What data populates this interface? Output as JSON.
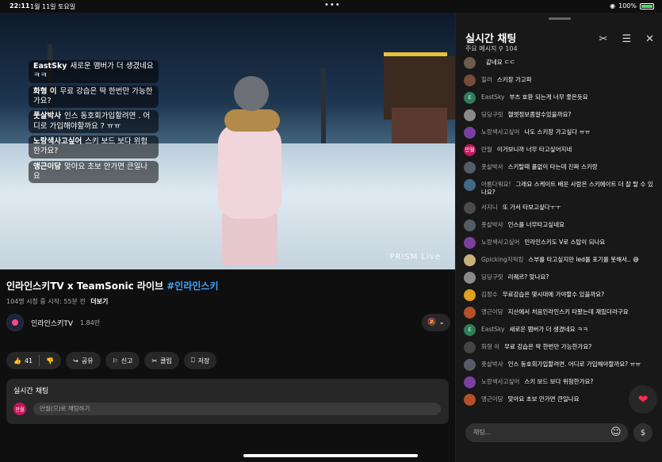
{
  "status_bar": {
    "time": "22:11",
    "date": "1월 11일 토요일",
    "battery": "100%"
  },
  "video": {
    "watermark": "PRISM Live",
    "overlay_messages": [
      {
        "author": "EastSky",
        "text": "새로운 맴버가 더 생겼네요 ㅋㅋ"
      },
      {
        "author": "화형 이",
        "text": "무료 강습은 딱 한번만 가능한가요?"
      },
      {
        "author": "풋살박사",
        "text": "인스 동호회가입할려면 . 어디로 가입해야할까요 ? ㅠㅠ"
      },
      {
        "author": "노랑색사고싶어",
        "text": "스키 보드 보다 위험한가요?"
      },
      {
        "author": "앵근이당",
        "text": "맞아요 초보 안가면 큰일나요"
      }
    ]
  },
  "video_info": {
    "title": "인라인스키TV x TeamSonic 라이브 ",
    "hashtag": "#인라인스키",
    "meta": "104명 시청 중  시작: 55분 전",
    "more": "더보기"
  },
  "channel": {
    "name": "인라인스키TV",
    "subs": "1.84만"
  },
  "actions": {
    "likes": "41",
    "share": "공유",
    "report": "신고",
    "clip": "클립",
    "save": "저장"
  },
  "live_chat_box": {
    "header": "실시간 채팅",
    "avatar": "만월",
    "placeholder": "만월(으)로 채팅하기"
  },
  "panel": {
    "title": "실시간 채팅",
    "subtitle": "주요 메시지",
    "viewers": "104",
    "messages": [
      {
        "avatar": "",
        "avatar_color": "#6d5b4a",
        "author": "",
        "text": "같네요 ㄷㄷ"
      },
      {
        "avatar": "",
        "avatar_color": "#7a4a3a",
        "author": "힐러",
        "text": "스키장 가고파"
      },
      {
        "avatar": "E",
        "avatar_color": "#2e7d5b",
        "author": "EastSky",
        "text": "부츠 호환 되는게 너무 좋은듯요"
      },
      {
        "avatar": "",
        "avatar_color": "#8a8a8a",
        "author": "딩딩구릿",
        "text": "헬멧정보좀알수있을까요?"
      },
      {
        "avatar": "",
        "avatar_color": "#7b3fa0",
        "author": "노랑색사고싶어",
        "text": "나도 스키장 가고싶다 ㅠㅠ"
      },
      {
        "avatar": "만월",
        "avatar_color": "#c2185b",
        "author": "만월",
        "text": "이거보니까 너무 타고싶어지네"
      },
      {
        "avatar": "",
        "avatar_color": "#555c66",
        "author": "풋살박사",
        "text": "스키탈때 폴없이 타는데 진짜 스키랑"
      },
      {
        "avatar": "",
        "avatar_color": "#3f6a8a",
        "author": "아름다워요!",
        "text": "그래요 스케이트 배운 사람은 스키에이트 더 잘 탈 수 있나요?"
      },
      {
        "avatar": "",
        "avatar_color": "#4b4b4b",
        "author": "서지니",
        "text": "또 가서 타보고싶다ㅜㅜ"
      },
      {
        "avatar": "",
        "avatar_color": "#555c66",
        "author": "풋살박사",
        "text": "인스를 너무타고싶네요"
      },
      {
        "avatar": "",
        "avatar_color": "#7b3fa0",
        "author": "노랑색사고싶어",
        "text": "인라인스키도 V로 스탑이 되나요"
      },
      {
        "avatar": "",
        "avatar_color": "#c9b17a",
        "author": "Gpicking지픽킹",
        "text": "스부를 타고싶지만 led를 포기를 못해서.. 😅"
      },
      {
        "avatar": "",
        "avatar_color": "#8a8a8a",
        "author": "딩딩구릿",
        "text": "리퀘르? 맞나요?"
      },
      {
        "avatar": "",
        "avatar_color": "#e0a020",
        "author": "김정수",
        "text": "무료강습은 몇시대에 가야할수 있을까요?"
      },
      {
        "avatar": "",
        "avatar_color": "#b5502a",
        "author": "앵근이당",
        "text": "지산에서 처음인라인스키 타봤는데 재밌더라구요"
      },
      {
        "avatar": "E",
        "avatar_color": "#2e7d5b",
        "author": "EastSky",
        "text": "새로운 맴버가 더 생겼네요 ㅋㅋ"
      },
      {
        "avatar": "",
        "avatar_color": "#444",
        "author": "화형 이",
        "text": "무료 강습은 딱 한번만 가능한가요?"
      },
      {
        "avatar": "",
        "avatar_color": "#555c66",
        "author": "풋살박사",
        "text": "인스 동호회가입할려면. 어디로 가입해야할까요? ㅠㅠ"
      },
      {
        "avatar": "",
        "avatar_color": "#7b3fa0",
        "author": "노랑색사고싶어",
        "text": "스키 보드 보다 위험한가요?"
      },
      {
        "avatar": "",
        "avatar_color": "#b5502a",
        "author": "앵근이당",
        "text": "맞아요 초보 안가면 큰일나요"
      }
    ],
    "input_placeholder": "채팅..."
  }
}
